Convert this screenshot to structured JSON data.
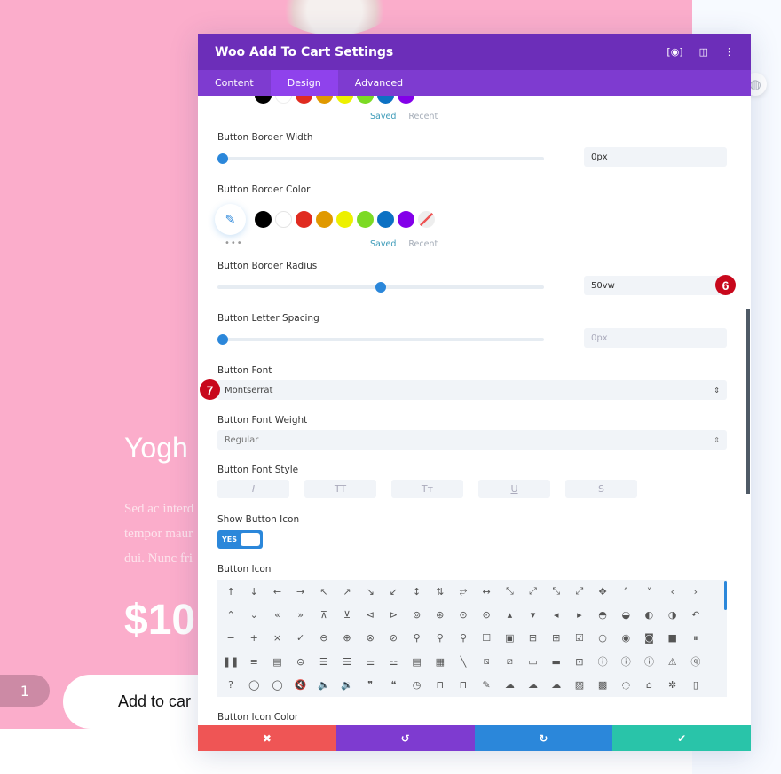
{
  "page": {
    "product_title": "Yogh",
    "product_desc_lines": [
      "Sed ac interd",
      "tempor maur",
      "dui. Nunc fri"
    ],
    "price": "$10.",
    "quantity": "1",
    "add_to_cart": "Add to car"
  },
  "modal": {
    "title": "Woo Add To Cart Settings",
    "header_icons": [
      "screenshot-icon",
      "split-view-icon",
      "more-vertical-icon"
    ],
    "tabs": [
      {
        "label": "Content",
        "active": false
      },
      {
        "label": "Design",
        "active": true
      },
      {
        "label": "Advanced",
        "active": false
      }
    ],
    "top_saved": "Saved",
    "top_recent": "Recent",
    "border_width": {
      "label": "Button Border Width",
      "value": "0px",
      "slider_fraction": 0.0
    },
    "border_color": {
      "label": "Button Border Color",
      "swatches": [
        "#000000",
        "#ffffff",
        "#e02b20",
        "#e09900",
        "#edf000",
        "#7cda24",
        "#0c71c3",
        "#8300e9"
      ],
      "saved": "Saved",
      "recent": "Recent"
    },
    "border_radius": {
      "label": "Button Border Radius",
      "value": "50vw",
      "slider_fraction": 0.5
    },
    "letter_spacing": {
      "label": "Button Letter Spacing",
      "placeholder": "0px",
      "slider_fraction": 0.0
    },
    "font": {
      "label": "Button Font",
      "value": "Montserrat"
    },
    "font_weight": {
      "label": "Button Font Weight",
      "value": "Regular"
    },
    "font_style": {
      "label": "Button Font Style",
      "buttons": [
        "I",
        "TT",
        "Tт",
        "U",
        "S"
      ]
    },
    "show_icon": {
      "label": "Show Button Icon",
      "toggle": "YES"
    },
    "button_icon": {
      "label": "Button Icon",
      "icons": [
        "↑",
        "↓",
        "←",
        "→",
        "↖",
        "↗",
        "↘",
        "↙",
        "↕",
        "⇅",
        "⥂",
        "↔",
        "⤡",
        "⤢",
        "⤡",
        "⤢",
        "✥",
        "˄",
        "˅",
        "‹",
        "›",
        "⌃",
        "⌄",
        "«",
        "»",
        "⊼",
        "⊻",
        "⊲",
        "⊳",
        "⊚",
        "⊛",
        "⊙",
        "⊙",
        "▴",
        "▾",
        "◂",
        "▸",
        "◓",
        "◒",
        "◐",
        "◑",
        "↶",
        "−",
        "+",
        "×",
        "✓",
        "⊖",
        "⊕",
        "⊗",
        "⊘",
        "⚲",
        "⚲",
        "⚲",
        "☐",
        "▣",
        "⊟",
        "⊞",
        "☑",
        "○",
        "◉",
        "◙",
        "■",
        "⏸",
        "❚❚",
        "≡",
        "▤",
        "⊜",
        "☰",
        "☰",
        "⚌",
        "⚍",
        "▤",
        "▦",
        "╲",
        "⧅",
        "⧄",
        "▭",
        "▬",
        "⊡",
        "ⓘ",
        "ⓘ",
        "ⓘ",
        "⚠",
        "ⓠ",
        "?",
        "◯",
        "◯",
        "🔇",
        "🔈",
        "🔉",
        "❞",
        "❝",
        "◷",
        "⊓",
        "⊓",
        "✎",
        "☁",
        "☁",
        "☁",
        "▨",
        "▩",
        "◌",
        "⌂",
        "✲",
        "▯"
      ]
    },
    "icon_color_label": "Button Icon Color",
    "badges": {
      "six": "6",
      "seven": "7"
    },
    "footer": [
      {
        "name": "cancel-button",
        "icon": "✖",
        "color": "#ef5555"
      },
      {
        "name": "undo-button",
        "icon": "↺",
        "color": "#7e3bd0"
      },
      {
        "name": "redo-button",
        "icon": "↻",
        "color": "#2b87da"
      },
      {
        "name": "save-button",
        "icon": "✔",
        "color": "#29c4a9"
      }
    ]
  }
}
